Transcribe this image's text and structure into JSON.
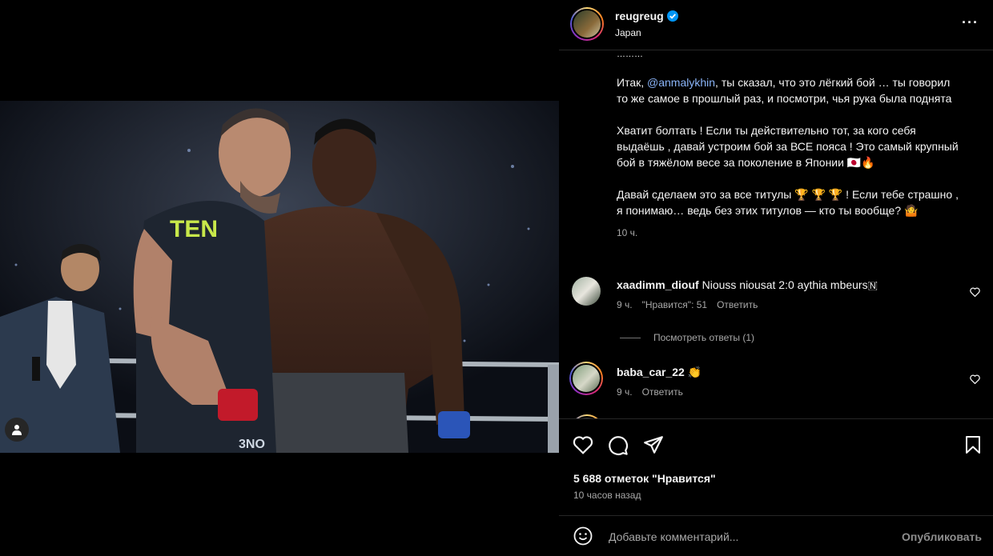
{
  "post": {
    "username": "reugreug",
    "location": "Japan",
    "verified_icon": "verified-badge-icon",
    "more_icon": "more-options-icon",
    "more_label": "···"
  },
  "caption": {
    "dots": "………",
    "p1_prefix": "Итак, ",
    "p1_mention": "@anmalykhin",
    "p1_suffix": ", ты сказал, что это лёгкий бой … ты говорил то же самое в прошлый раз, и посмотри, чья рука была поднята",
    "p2": "Хватит болтать ! Если ты действительно тот, за кого себя выдаёшь , давай устроим бой за ВСЕ пояса ! Это самый крупный бой в тяжёлом весе за поколение в Японии 🇯🇵🔥",
    "p3": "Давай сделаем это за все титулы 🏆 🏆 🏆 ! Если тебе страшно , я понимаю… ведь без этих титулов — кто ты вообще? 🤷",
    "time": "10 ч."
  },
  "comments": [
    {
      "username": "xaadimm_diouf",
      "text": "Niouss niousat 2:0 aythia mbeurs🇳",
      "time": "9 ч.",
      "likes": "\"Нравится\": 51",
      "reply": "Ответить",
      "view_replies": "Посмотреть ответы (1)"
    },
    {
      "username": "baba_car_22",
      "text": "👏",
      "time": "9 ч.",
      "reply": "Ответить"
    }
  ],
  "actions": {
    "likes": "5 688 отметок \"Нравится\"",
    "ago": "10 часов назад"
  },
  "add_comment": {
    "placeholder": "Добавьте комментарий...",
    "publish": "Опубликовать"
  },
  "photo": {
    "shirt_text": "TEN",
    "glove_text": "3NO"
  },
  "colors": {
    "background": "#000000",
    "mention": "#8ab4f8",
    "secondary_text": "#a8a8a8",
    "verified": "#0095f6"
  }
}
